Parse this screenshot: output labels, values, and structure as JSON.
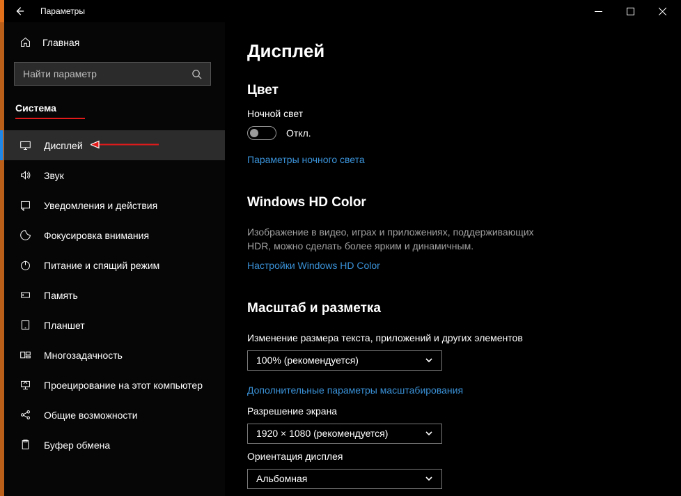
{
  "window": {
    "title": "Параметры"
  },
  "sidebar": {
    "home_label": "Главная",
    "search_placeholder": "Найти параметр",
    "category": "Система",
    "items": [
      {
        "id": "display",
        "label": "Дисплей",
        "selected": true
      },
      {
        "id": "sound",
        "label": "Звук"
      },
      {
        "id": "notifications",
        "label": "Уведомления и действия"
      },
      {
        "id": "focus",
        "label": "Фокусировка внимания"
      },
      {
        "id": "power",
        "label": "Питание и спящий режим"
      },
      {
        "id": "storage",
        "label": "Память"
      },
      {
        "id": "tablet",
        "label": "Планшет"
      },
      {
        "id": "multitask",
        "label": "Многозадачность"
      },
      {
        "id": "projecting",
        "label": "Проецирование на этот компьютер"
      },
      {
        "id": "shared",
        "label": "Общие возможности"
      },
      {
        "id": "clipboard",
        "label": "Буфер обмена"
      }
    ]
  },
  "main": {
    "title": "Дисплей",
    "color_section": "Цвет",
    "night_light_label": "Ночной свет",
    "night_light_state": "Откл.",
    "night_light_link": "Параметры ночного света",
    "hd_color_section": "Windows HD Color",
    "hd_color_desc": "Изображение в видео, играх и приложениях, поддерживающих HDR, можно сделать более ярким и динамичным.",
    "hd_color_link": "Настройки Windows HD Color",
    "scale_section": "Масштаб и разметка",
    "scale_label": "Изменение размера текста, приложений и других элементов",
    "scale_value": "100% (рекомендуется)",
    "scale_link": "Дополнительные параметры масштабирования",
    "resolution_label": "Разрешение экрана",
    "resolution_value": "1920 × 1080 (рекомендуется)",
    "orientation_label": "Ориентация дисплея",
    "orientation_value": "Альбомная"
  }
}
